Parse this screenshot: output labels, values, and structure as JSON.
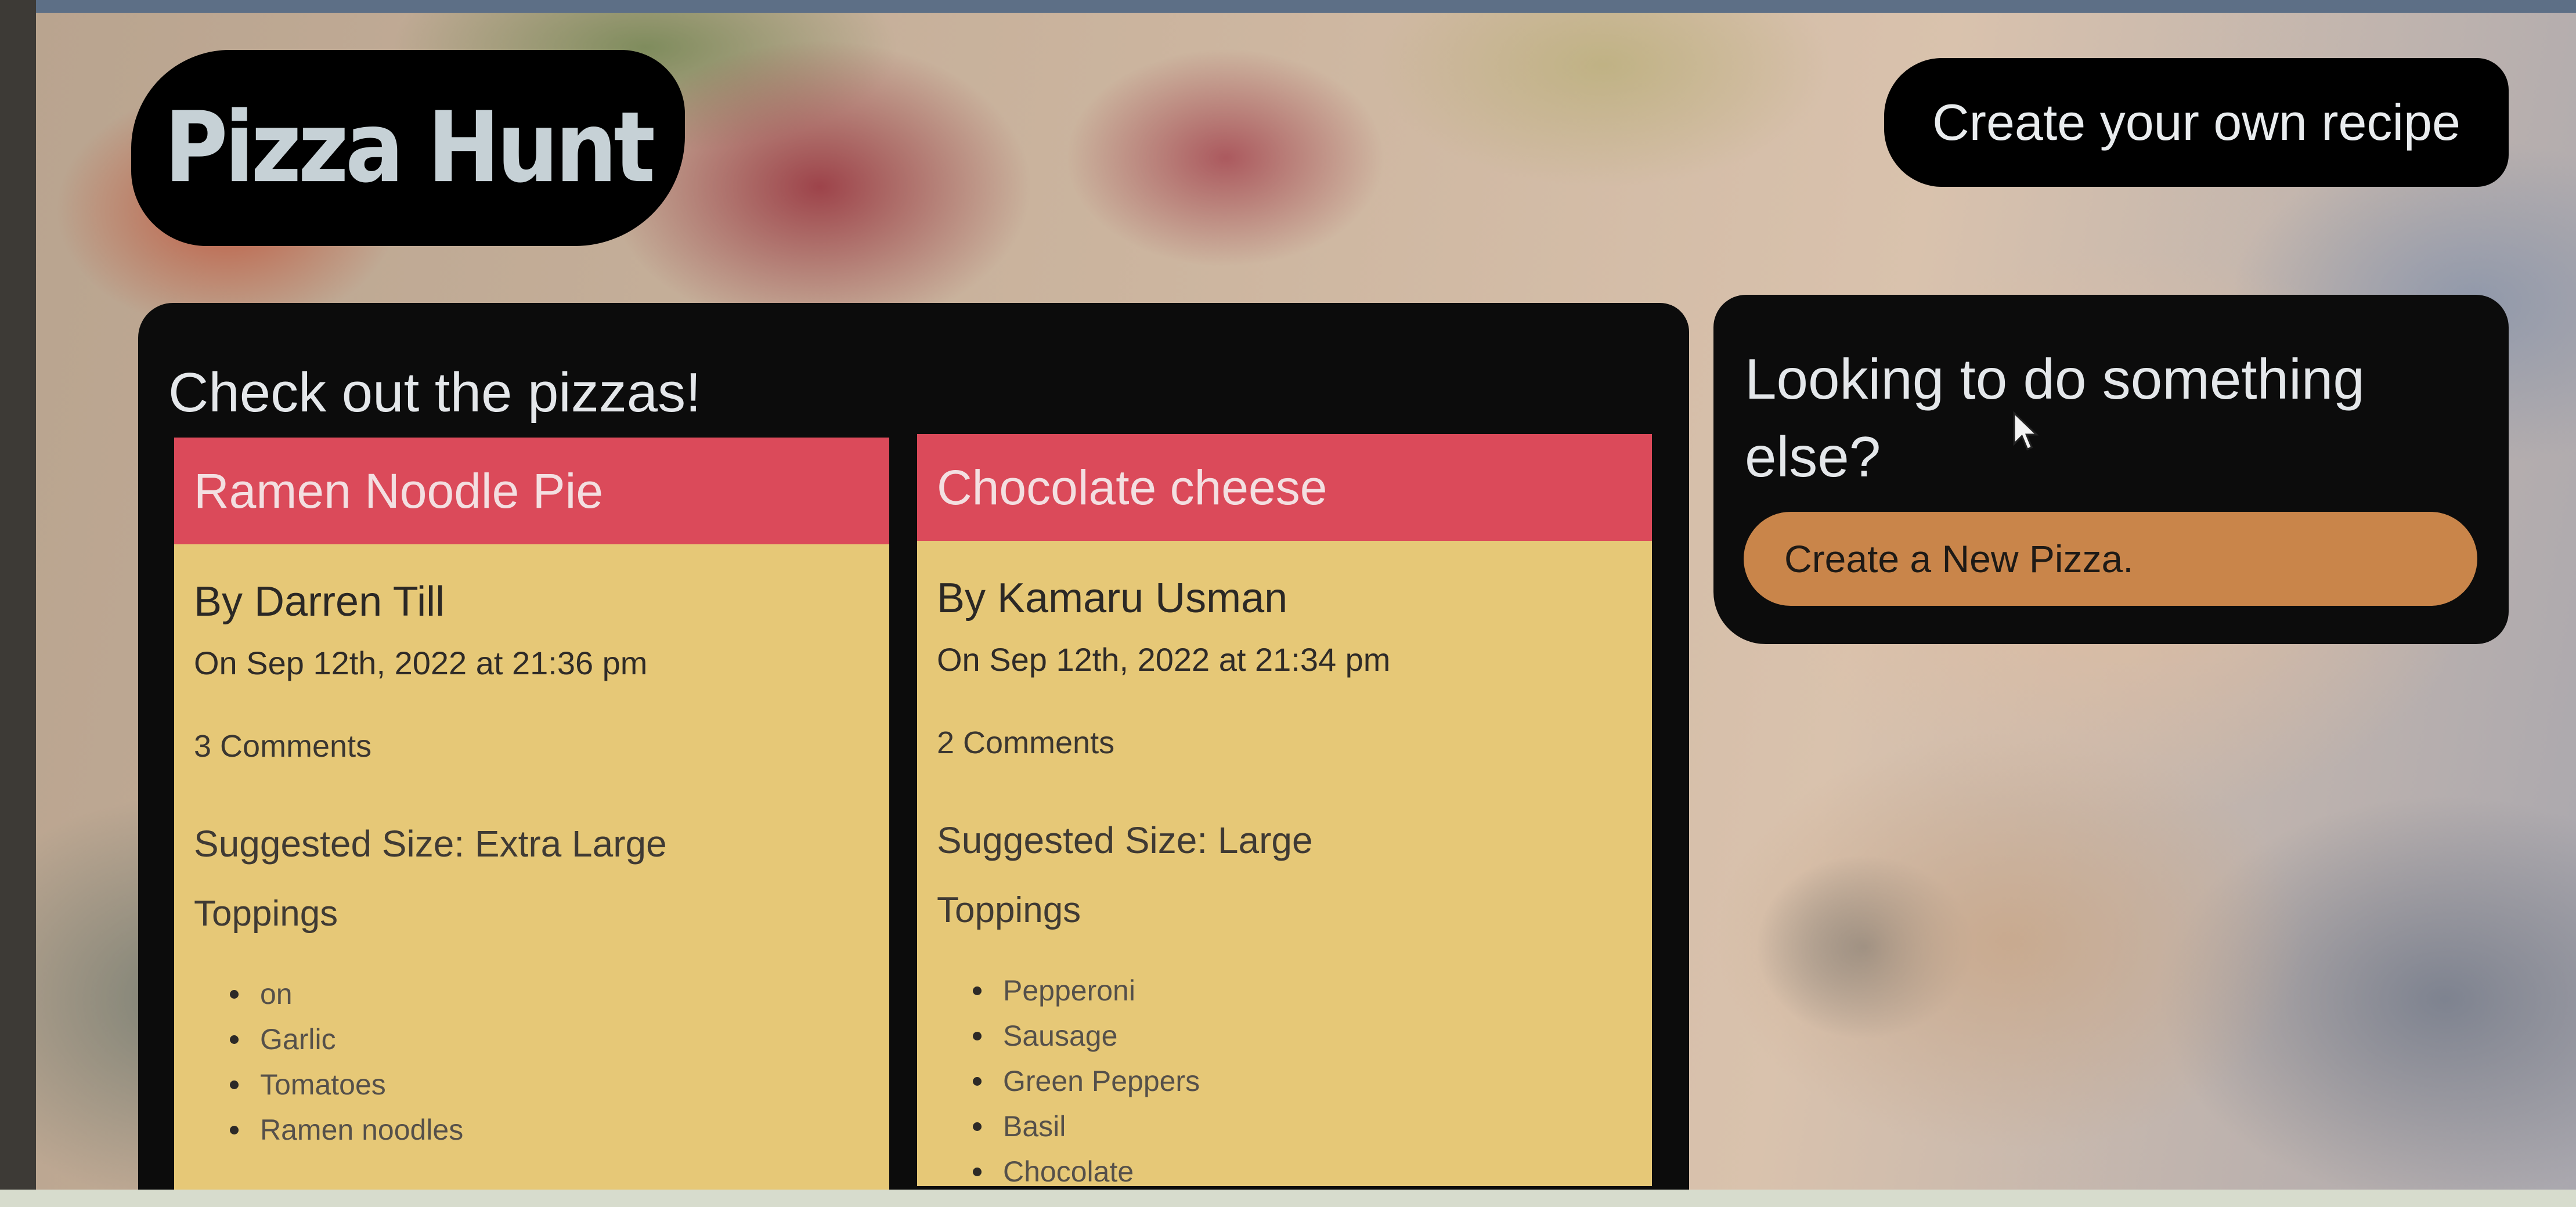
{
  "header": {
    "logo": "Pizza Hunt",
    "create_recipe_link": "Create your own recipe"
  },
  "main": {
    "heading": "Check out the pizzas!",
    "pizzas": [
      {
        "name": "Ramen Noodle Pie",
        "author": "By Darren Till",
        "date": "On Sep 12th, 2022 at 21:36 pm",
        "comments": "3 Comments",
        "size": "Suggested Size: Extra Large",
        "toppings_label": "Toppings",
        "toppings": [
          "on",
          "Garlic",
          "Tomatoes",
          "Ramen noodles"
        ]
      },
      {
        "name": "Chocolate cheese",
        "author": "By Kamaru Usman",
        "date": "On Sep 12th, 2022 at 21:34 pm",
        "comments": "2 Comments",
        "size": "Suggested Size: Large",
        "toppings_label": "Toppings",
        "toppings": [
          "Pepperoni",
          "Sausage",
          "Green Peppers",
          "Basil",
          "Chocolate"
        ]
      }
    ]
  },
  "sidebar": {
    "heading": "Looking to do something else?",
    "button_label": "Create a New Pizza."
  },
  "colors": {
    "panel": "#0c0c0c",
    "card_header": "#db4a5a",
    "card_body": "#e6c877",
    "button": "#c9854a"
  }
}
